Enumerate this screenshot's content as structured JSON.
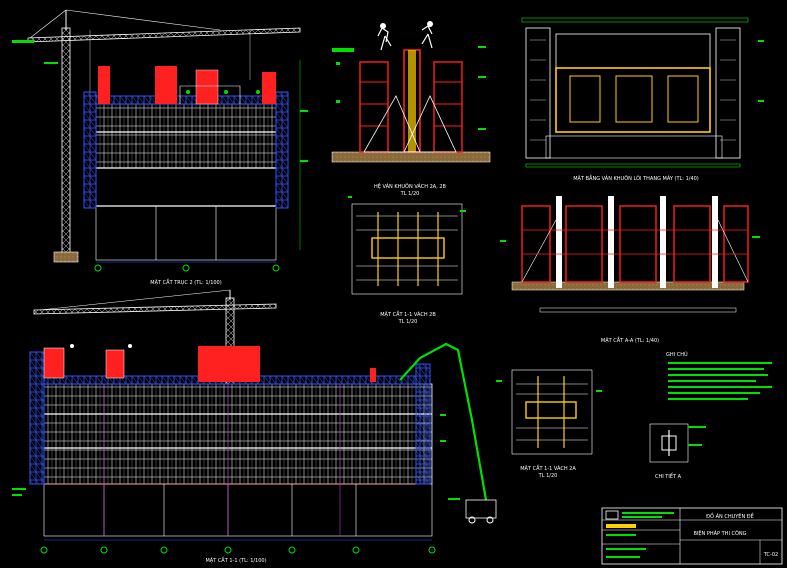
{
  "drawing": {
    "views": [
      {
        "id": "elevation-top",
        "caption": "MẶT CẮT TRỤC 2 (TL: 1/100)"
      },
      {
        "id": "wall-formwork",
        "caption": "HỆ VÁN KHUÔN VÁCH 2A, 2B",
        "scale": "TL 1/20"
      },
      {
        "id": "elevator-core-plan",
        "caption": "MẶT BẰNG VÁN KHUÔN LÕI THANG MÁY (TL: 1/40)"
      },
      {
        "id": "section-1-1-2b",
        "caption": "MẶT CẮT 1-1 VÁCH 2B",
        "scale": "TL 1/20"
      },
      {
        "id": "section-a-a",
        "caption": "MẶT CẮT A-A (TL: 1/40)"
      },
      {
        "id": "elevation-bottom",
        "caption": "MẶT CẮT 1-1 (TL: 1/100)"
      },
      {
        "id": "section-1-1-2a",
        "caption": "MẶT CẮT 1-1 VÁCH 2A",
        "scale": "TL 1/20"
      },
      {
        "id": "detail-a",
        "caption": "CHI TIẾT A"
      }
    ],
    "notes_title": "GHI CHÚ",
    "title_block": {
      "project": "ĐỒ ÁN CHUYÊN ĐỀ",
      "sheet_title": "BIỆN PHÁP THI CÔNG",
      "sheet_no": "TC-02"
    }
  },
  "colors": {
    "background": "#000000",
    "linework": "#ffffff",
    "scaffold": "#3355ff",
    "formwork": "#ff2020",
    "annotation": "#00e000",
    "gridline": "#cc33cc",
    "accent": "#ffd000"
  }
}
